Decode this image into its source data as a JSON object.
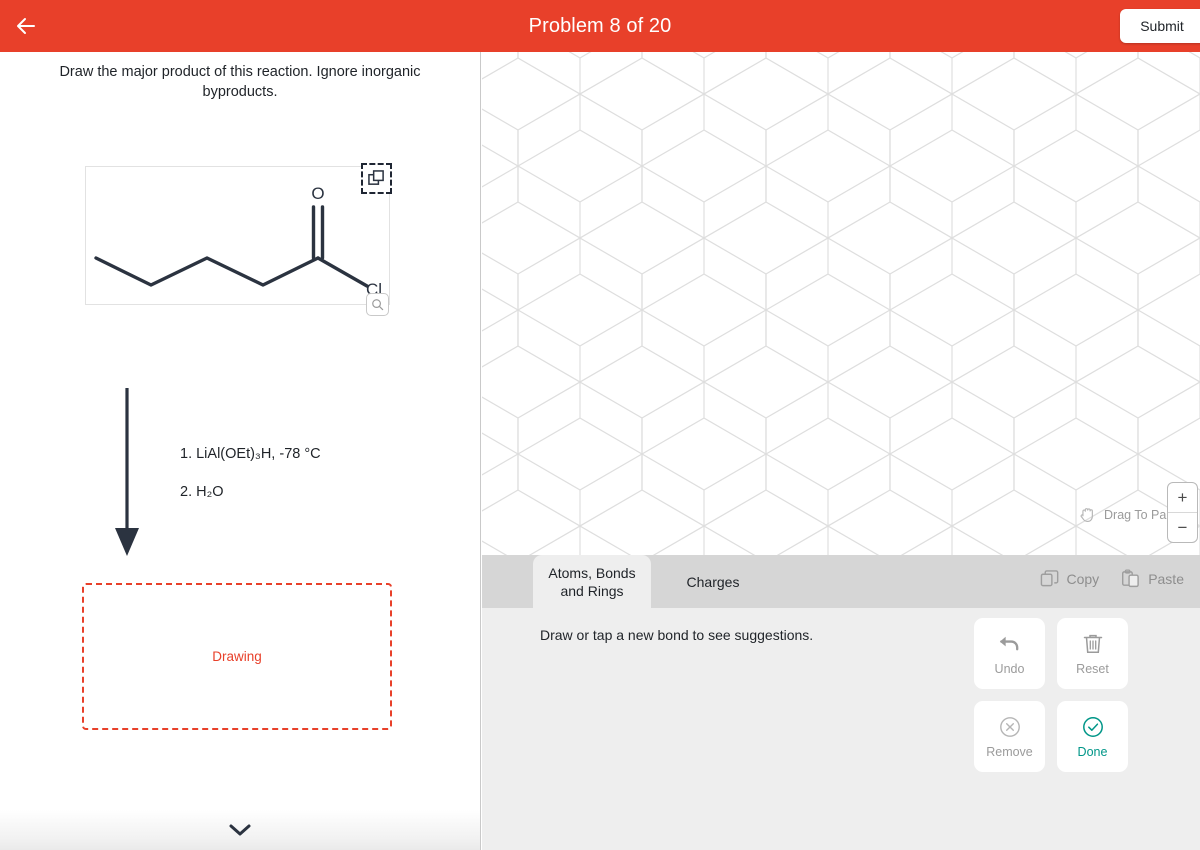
{
  "header": {
    "back_icon": "arrow-left-icon",
    "title": "Problem 8 of 20",
    "submit_label": "Submit",
    "accent_color": "#e8402a"
  },
  "left_panel": {
    "prompt": "Draw the major product of this reaction. Ignore inorganic byproducts.",
    "molecule": {
      "name": "acyl-chloride-reactant",
      "atom_labels": [
        "O",
        "Cl"
      ],
      "oxygen_label": "O",
      "chlorine_label": "Cl",
      "copy_handle_icon": "duplicate-icon",
      "zoom_handle_icon": "magnify-icon"
    },
    "reagents": [
      "1. LiAl(OEt)₃H, -78 °C",
      "2. H₂O"
    ],
    "dropzone": {
      "label": "Drawing",
      "border_color": "#e8402a"
    },
    "footer_icon": "chevron-down-icon"
  },
  "canvas": {
    "grid_type": "hexagon",
    "pan_hint": "Drag To Pan",
    "pan_icon": "hand-icon",
    "zoom_in": "+",
    "zoom_out": "−"
  },
  "toolbar": {
    "tabs": [
      {
        "label": "Atoms, Bonds and Rings",
        "line1": "Atoms, Bonds",
        "line2": "and Rings",
        "active": true
      },
      {
        "label": "Charges",
        "line1": "Charges",
        "line2": "",
        "active": false
      }
    ],
    "clipboard": [
      {
        "label": "Copy",
        "icon": "copy-icon"
      },
      {
        "label": "Paste",
        "icon": "paste-icon"
      }
    ],
    "hint": "Draw or tap a new bond to see suggestions.",
    "actions": [
      {
        "label": "Undo",
        "icon": "undo-arrow-icon",
        "color": "#9b9b9b"
      },
      {
        "label": "Reset",
        "icon": "trash-icon",
        "color": "#9b9b9b"
      },
      {
        "label": "Remove",
        "icon": "x-circle-icon",
        "color": "#9b9b9b"
      },
      {
        "label": "Done",
        "icon": "check-circle-icon",
        "color": "#009688"
      }
    ]
  }
}
